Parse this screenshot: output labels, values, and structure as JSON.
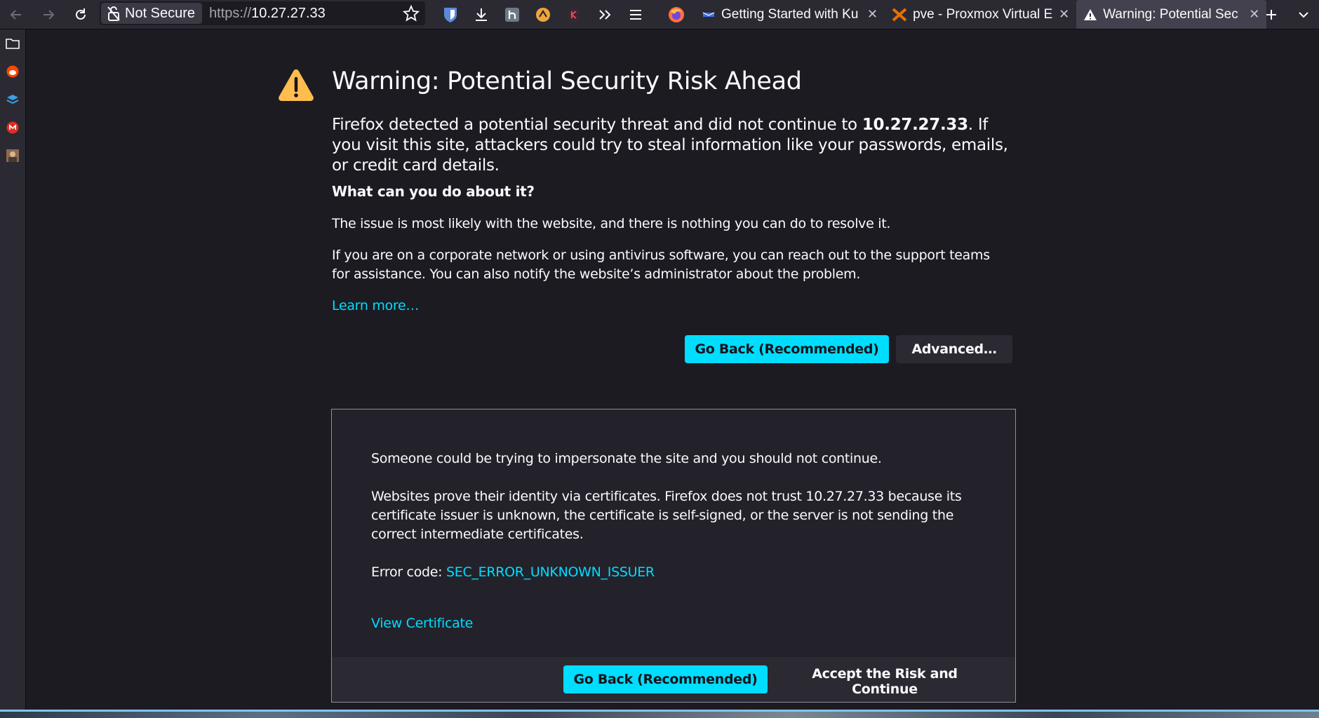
{
  "toolbar": {
    "not_secure_label": "Not Secure",
    "url_scheme": "https://",
    "url_host": "10.27.27.33"
  },
  "tabs": [
    {
      "label": "Getting Started with Ku",
      "icon": "kubernetes-icon",
      "active": false
    },
    {
      "label": "pve - Proxmox Virtual E",
      "icon": "proxmox-icon",
      "active": false
    },
    {
      "label": "Warning: Potential Sec",
      "icon": "warning-icon",
      "active": true
    }
  ],
  "page": {
    "title": "Warning: Potential Security Risk Ahead",
    "intro_before": "Firefox detected a potential security threat and did not continue to ",
    "intro_host": "10.27.27.33",
    "intro_after": ". If you visit this site, attackers could try to steal information like your passwords, emails, or credit card details.",
    "subhead": "What can you do about it?",
    "para1": "The issue is most likely with the website, and there is nothing you can do to resolve it.",
    "para2": "If you are on a corporate network or using antivirus software, you can reach out to the support teams for assistance. You can also notify the website’s administrator about the problem.",
    "learn_more": "Learn more…",
    "go_back": "Go Back (Recommended)",
    "advanced": "Advanced…"
  },
  "advanced_panel": {
    "text1": "Someone could be trying to impersonate the site and you should not continue.",
    "text2": "Websites prove their identity via certificates. Firefox does not trust 10.27.27.33 because its certificate issuer is unknown, the certificate is self-signed, or the server is not sending the correct intermediate certificates.",
    "error_label": "Error code: ",
    "error_code": "SEC_ERROR_UNKNOWN_ISSUER",
    "view_certificate": "View Certificate",
    "go_back": "Go Back (Recommended)",
    "accept": "Accept the Risk and Continue"
  },
  "colors": {
    "accent": "#00ddff",
    "warning": "#ffbd4f",
    "background": "#1c1b22"
  }
}
